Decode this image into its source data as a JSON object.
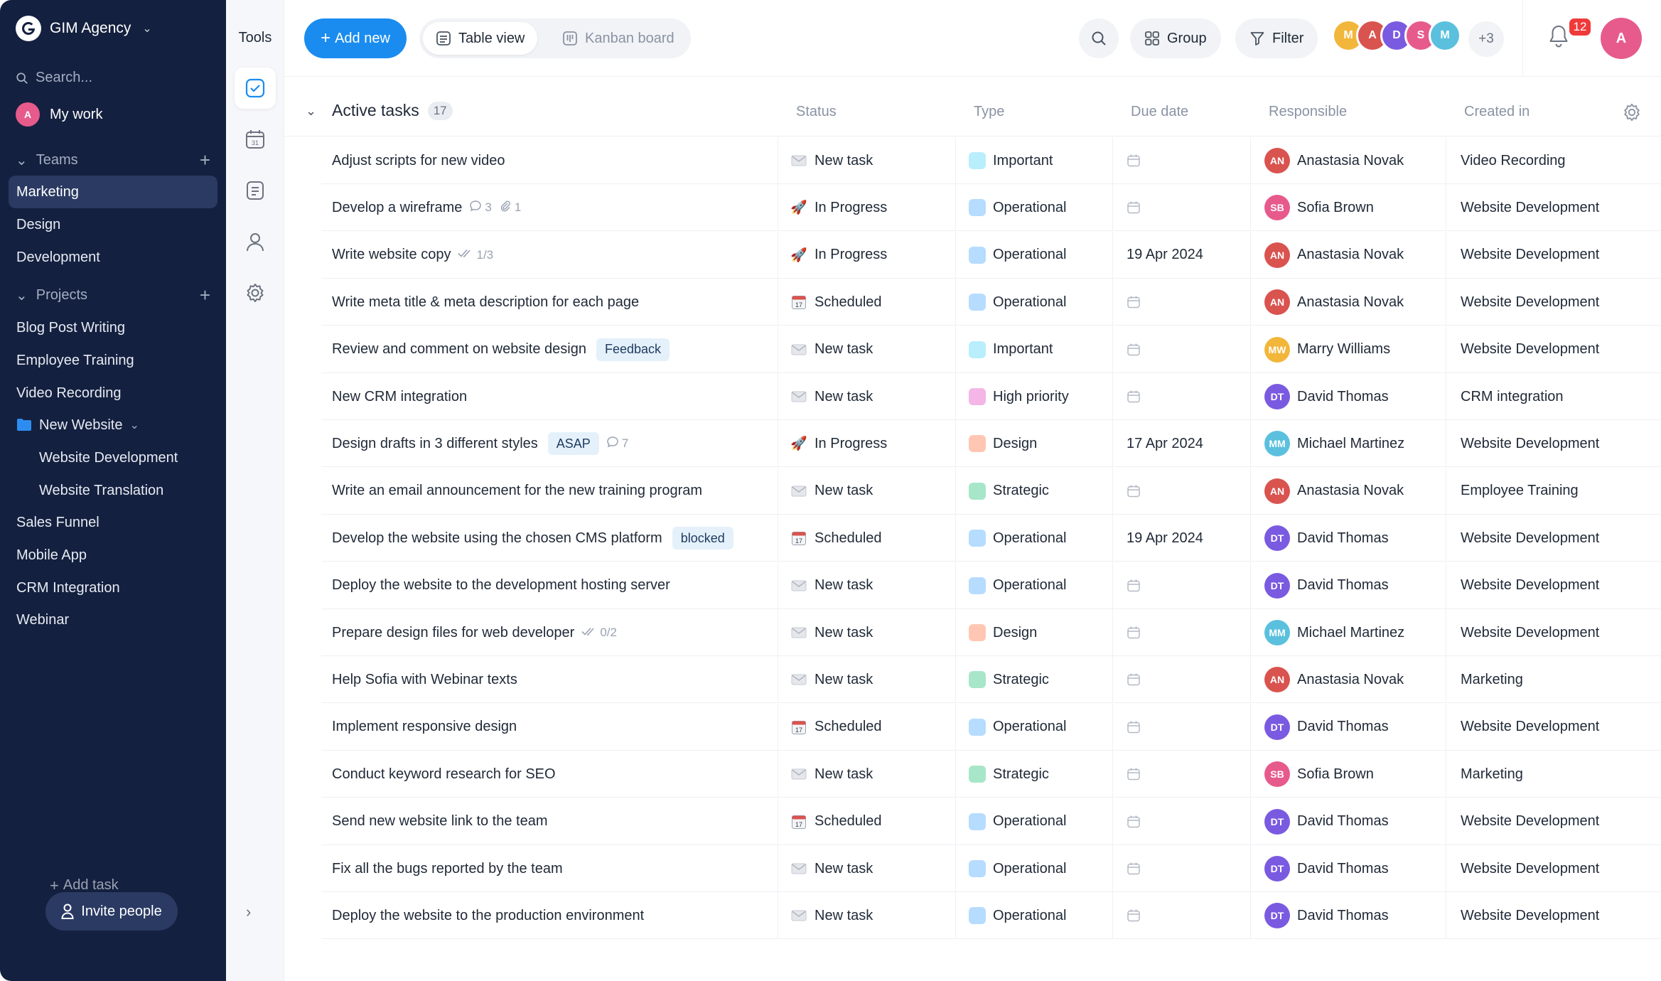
{
  "sidebar": {
    "workspace": "GIM Agency",
    "search_placeholder": "Search...",
    "my_work": "My work",
    "teams_label": "Teams",
    "teams": [
      "Marketing",
      "Design",
      "Development"
    ],
    "projects_label": "Projects",
    "projects": [
      "Blog Post Writing",
      "Employee Training",
      "Video Recording"
    ],
    "folder": {
      "label": "New Website",
      "children": [
        "Website Development",
        "Website Translation"
      ]
    },
    "projects_more": [
      "Sales Funnel",
      "Mobile App",
      "CRM Integration",
      "Webinar"
    ],
    "invite_label": "Invite people"
  },
  "tools": {
    "title": "Tools"
  },
  "topbar": {
    "add_new": "Add new",
    "views": [
      "Table view",
      "Kanban board"
    ],
    "group": "Group",
    "filter": "Filter",
    "more_members": "+3",
    "notifications": "12"
  },
  "group": {
    "title": "Active tasks",
    "count": "17"
  },
  "columns": {
    "status": "Status",
    "type": "Type",
    "due": "Due date",
    "responsible": "Responsible",
    "created": "Created in"
  },
  "colors": {
    "accent": "#1a8cf0",
    "sidebar_bg": "#14203f",
    "type_important": "#b9eefc",
    "type_operational": "#b6dcff",
    "type_high_priority": "#f3b6e6",
    "type_design": "#ffc7b3",
    "type_strategic": "#a8e6c9"
  },
  "tasks": [
    {
      "name": "Adjust scripts for new video",
      "status": "New task",
      "type": "Important",
      "due": "",
      "responsible": "Anastasia Novak",
      "created": "Video Recording"
    },
    {
      "name": "Develop a wireframe",
      "comments": "3",
      "attachments": "1",
      "status": "In Progress",
      "type": "Operational",
      "due": "",
      "responsible": "Sofia Brown",
      "created": "Website Development"
    },
    {
      "name": "Write website copy",
      "checklist": "1/3",
      "status": "In Progress",
      "type": "Operational",
      "due": "19 Apr 2024",
      "responsible": "Anastasia Novak",
      "created": "Website Development"
    },
    {
      "name": "Write meta title & meta description for each page",
      "status": "Scheduled",
      "type": "Operational",
      "due": "",
      "responsible": "Anastasia Novak",
      "created": "Website Development"
    },
    {
      "name": "Review and comment on website design",
      "tag": "Feedback",
      "status": "New task",
      "type": "Important",
      "due": "",
      "responsible": "Marry Williams",
      "created": "Website Development"
    },
    {
      "name": "New CRM integration",
      "status": "New task",
      "type": "High priority",
      "due": "",
      "responsible": "David Thomas",
      "created": "CRM integration"
    },
    {
      "name": "Design drafts in 3 different styles",
      "tag": "ASAP",
      "comments": "7",
      "status": "In Progress",
      "type": "Design",
      "due": "17 Apr 2024",
      "responsible": "Michael Martinez",
      "created": "Website Development"
    },
    {
      "name": "Write an email announcement for the new training program",
      "status": "New task",
      "type": "Strategic",
      "due": "",
      "responsible": "Anastasia Novak",
      "created": "Employee Training"
    },
    {
      "name": "Develop the website using the chosen CMS platform",
      "tag": "blocked",
      "status": "Scheduled",
      "type": "Operational",
      "due": "19 Apr 2024",
      "responsible": "David Thomas",
      "created": "Website Development"
    },
    {
      "name": "Deploy the website to the development hosting server",
      "status": "New task",
      "type": "Operational",
      "due": "",
      "responsible": "David Thomas",
      "created": "Website Development"
    },
    {
      "name": "Prepare design files for web developer",
      "checklist": "0/2",
      "status": "New task",
      "type": "Design",
      "due": "",
      "responsible": "Michael Martinez",
      "created": "Website Development"
    },
    {
      "name": "Help Sofia with Webinar texts",
      "status": "New task",
      "type": "Strategic",
      "due": "",
      "responsible": "Anastasia Novak",
      "created": "Marketing"
    },
    {
      "name": "Implement responsive design",
      "status": "Scheduled",
      "type": "Operational",
      "due": "",
      "responsible": "David Thomas",
      "created": "Website Development"
    },
    {
      "name": "Conduct keyword research for SEO",
      "status": "New task",
      "type": "Strategic",
      "due": "",
      "responsible": "Sofia Brown",
      "created": "Marketing"
    },
    {
      "name": "Send new website link to the team",
      "status": "Scheduled",
      "type": "Operational",
      "due": "",
      "responsible": "David Thomas",
      "created": "Website Development"
    },
    {
      "name": "Fix all the bugs reported by the team",
      "status": "New task",
      "type": "Operational",
      "due": "",
      "responsible": "David Thomas",
      "created": "Website Development"
    },
    {
      "name": "Deploy the website to the production environment",
      "status": "New task",
      "type": "Operational",
      "due": "",
      "responsible": "David Thomas",
      "created": "Website Development"
    }
  ],
  "add_task": "Add task"
}
